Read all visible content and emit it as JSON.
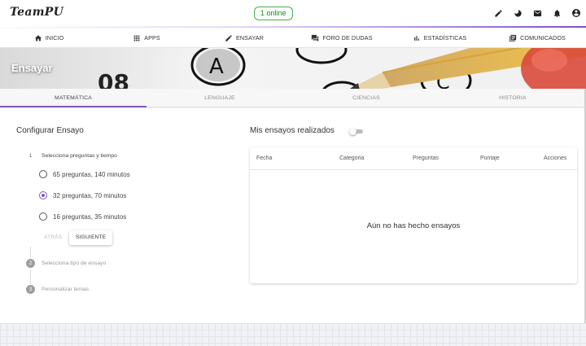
{
  "header": {
    "brand": "TeamPU",
    "online_badge": "1 online",
    "icons": [
      "pencil-icon",
      "moon-icon",
      "mail-icon",
      "bell-icon",
      "account-icon"
    ]
  },
  "nav": [
    {
      "label": "INICIO",
      "icon": "home-icon"
    },
    {
      "label": "APPS",
      "icon": "apps-grid-icon"
    },
    {
      "label": "ENSAYAR",
      "icon": "pencil-icon"
    },
    {
      "label": "FORO DE DUDAS",
      "icon": "forum-icon"
    },
    {
      "label": "ESTADÍSTICAS",
      "icon": "bar-chart-icon"
    },
    {
      "label": "COMUNICADOS",
      "icon": "library-icon"
    }
  ],
  "banner": {
    "title": "Ensayar"
  },
  "subject_tabs": [
    {
      "label": "MATEMÁTICA",
      "active": true
    },
    {
      "label": "LENGUAJE",
      "active": false
    },
    {
      "label": "CIENCIAS",
      "active": false
    },
    {
      "label": "HISTORIA",
      "active": false
    }
  ],
  "config": {
    "title": "Configurar Ensayo",
    "steps": [
      {
        "number": "1",
        "label": "Selecciona preguntas y tiempo"
      },
      {
        "number": "2",
        "label": "Selecciona tipo de ensayo"
      },
      {
        "number": "3",
        "label": "Personalizar temas"
      }
    ],
    "options": [
      {
        "label": "65 preguntas, 140 minutos",
        "checked": false
      },
      {
        "label": "32 preguntas, 70 minutos",
        "checked": true
      },
      {
        "label": "16 preguntas, 35 minutos",
        "checked": false
      }
    ],
    "back_label": "ATRÁS",
    "next_label": "SIGUIENTE"
  },
  "history": {
    "title": "Mis ensayos realizados",
    "toggle_on": false,
    "columns": [
      "Fecha",
      "Categoria",
      "Preguntas",
      "Puntaje",
      "Acciones"
    ],
    "empty_message": "Aún no has hecho ensayos"
  },
  "colors": {
    "accent": "#7e57c2",
    "online": "#4caf50"
  }
}
